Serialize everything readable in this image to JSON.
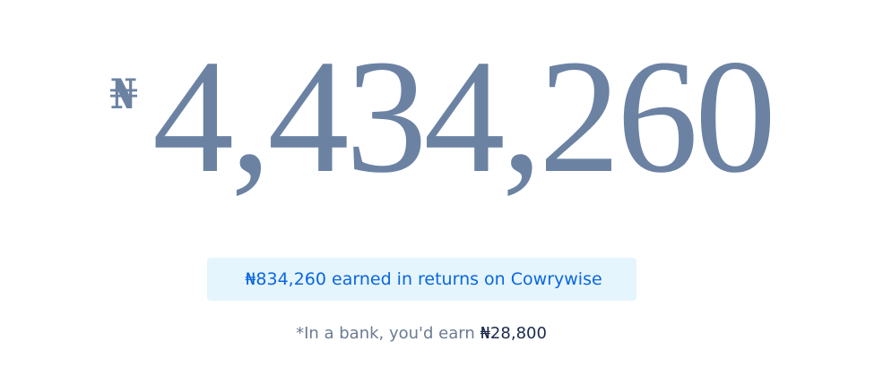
{
  "hero": {
    "currency_symbol": "₦",
    "amount": "4,434,260"
  },
  "returns_badge": {
    "text": "₦834,260 earned in returns on Cowrywise"
  },
  "bank_note": {
    "prefix": "*In a bank, you'd earn ",
    "amount": "₦28,800"
  },
  "colors": {
    "amount": "#6b82a3",
    "badge_background": "#e5f5fd",
    "badge_text": "#0a66e0",
    "note_text": "#6b7b93",
    "note_amount": "#1b2a4a"
  }
}
